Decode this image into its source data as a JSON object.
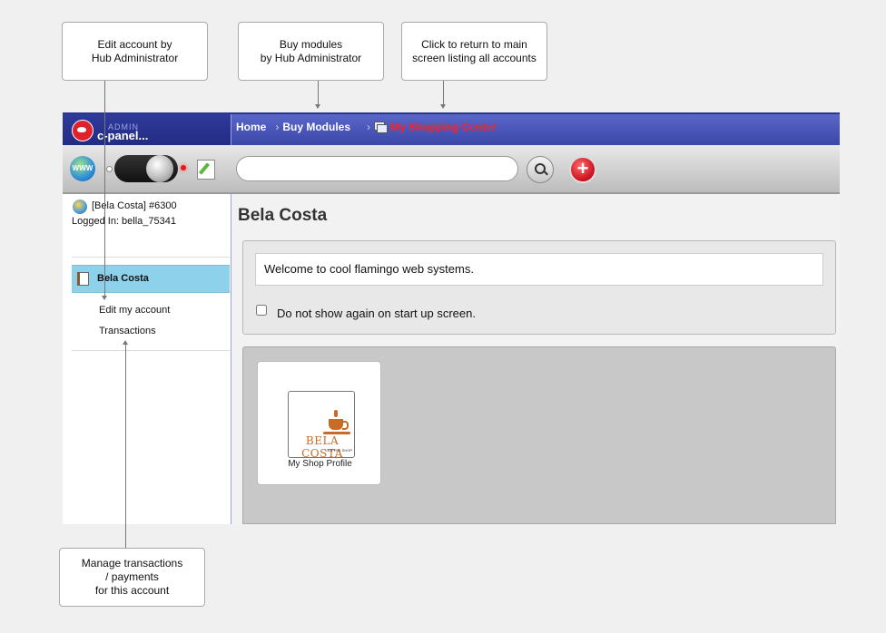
{
  "callouts": {
    "edit_account": [
      "Edit account by",
      "Hub Administrator"
    ],
    "buy_modules": [
      "Buy modules",
      "by Hub Administrator"
    ],
    "return_main": [
      "Click to return to main",
      "screen listing all accounts"
    ],
    "transactions": [
      "Manage transactions",
      "/ payments",
      "for this account"
    ]
  },
  "logo": {
    "admin": "ADMIN",
    "name": "c-panel..."
  },
  "nav": {
    "home": "Home",
    "buy_modules": "Buy Modules",
    "shopping_center": "My Shopping Center"
  },
  "toolbar": {
    "globe": "WWW",
    "search_value": "",
    "search_placeholder": "",
    "add_label": "+"
  },
  "sidebar": {
    "account_name": "[Bela Costa] #6300",
    "logged_in": "Logged In: bella_75341",
    "active_item": "Bela Costa",
    "links": [
      "Edit my account",
      "Transactions"
    ]
  },
  "main": {
    "title": "Bela Costa",
    "welcome": "Welcome to cool flamingo web systems.",
    "do_not_show": "Do not show again on start up screen."
  },
  "module": {
    "logo_text": "BELA COSTA",
    "logo_subtext": "COFFEE SHOP",
    "label": "My Shop Profile"
  },
  "colors": {
    "nav_bg": "#3c48a8",
    "active_nav": "#ff2020",
    "sidebar_active": "#8dd1ea",
    "brand": "#c86a28"
  }
}
